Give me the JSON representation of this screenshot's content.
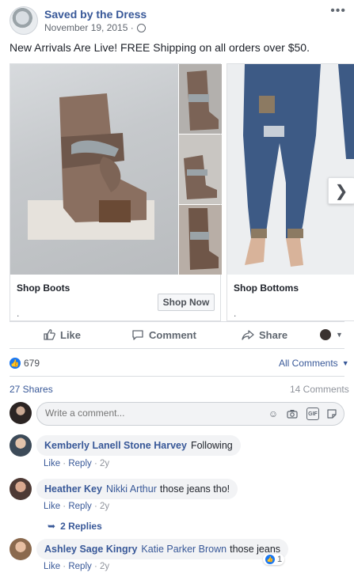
{
  "post": {
    "page_name": "Saved by the Dress",
    "timestamp": "November 19, 2015 ·",
    "text": "New Arrivals Are Live! FREE Shipping on all orders over $50."
  },
  "carousel": {
    "cards": [
      {
        "title": "Shop Boots",
        "subtitle": ".",
        "button": "Shop Now"
      },
      {
        "title": "Shop Bottoms",
        "subtitle": "."
      }
    ]
  },
  "actions": {
    "like": "Like",
    "comment": "Comment",
    "share": "Share"
  },
  "stats": {
    "reactions": "679",
    "all_comments": "All Comments",
    "shares": "27 Shares",
    "comments": "14 Comments"
  },
  "composer": {
    "placeholder": "Write a comment..."
  },
  "comments": [
    {
      "author": "Kemberly Lanell Stone Harvey",
      "mention": "",
      "text": "Following",
      "like": "Like",
      "reply": "Reply",
      "time": "2y"
    },
    {
      "author": "Heather Key",
      "mention": "Nikki Arthur",
      "text": "those jeans tho!",
      "like": "Like",
      "reply": "Reply",
      "time": "2y",
      "replies": "2 Replies"
    },
    {
      "author": "Ashley Sage Kingry",
      "mention": "Katie Parker Brown",
      "text": "those jeans",
      "like": "Like",
      "reply": "Reply",
      "time": "2y",
      "reaction_count": "1"
    }
  ],
  "colors": {
    "link": "#385898",
    "facebook_blue": "#1877f2",
    "bubble": "#f2f3f5"
  }
}
